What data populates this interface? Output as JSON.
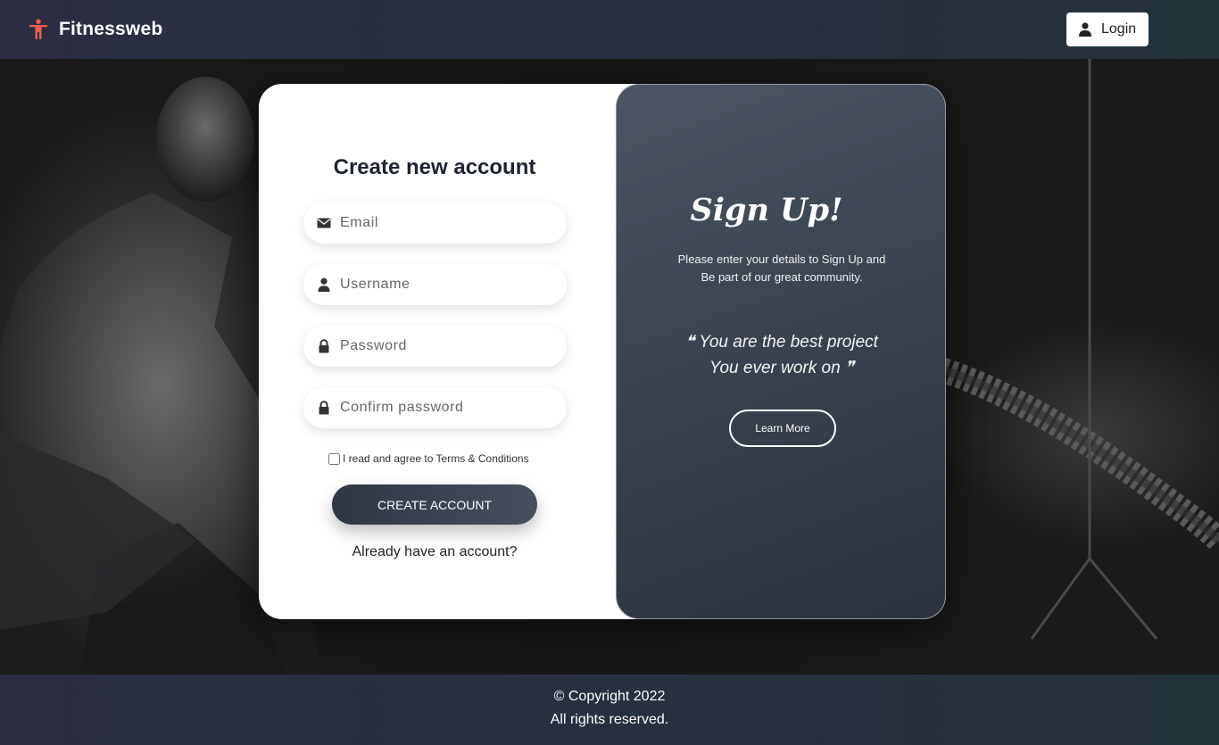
{
  "header": {
    "brand_name": "Fitnessweb",
    "brand_icon": "person-icon",
    "brand_color": "#ef5b4b",
    "login_label": "Login"
  },
  "form": {
    "title": "Create new account",
    "email_placeholder": "Email",
    "username_placeholder": "Username",
    "password_placeholder": "Password",
    "confirm_placeholder": "Confirm password",
    "terms_label": "I read and agree to Terms & Conditions",
    "terms_checked": false,
    "create_label": "CREATE ACCOUNT",
    "already_label": "Already have an account?"
  },
  "promo": {
    "title": "Sign Up!",
    "text_line1": "Please enter your details to Sign Up and",
    "text_line2": "Be part of our great community.",
    "quote_line1": "❝ You are the best project",
    "quote_line2": "You ever work on ❞",
    "learn_label": "Learn More"
  },
  "footer": {
    "copyright": "© Copyright 2022",
    "rights": "All rights reserved."
  }
}
